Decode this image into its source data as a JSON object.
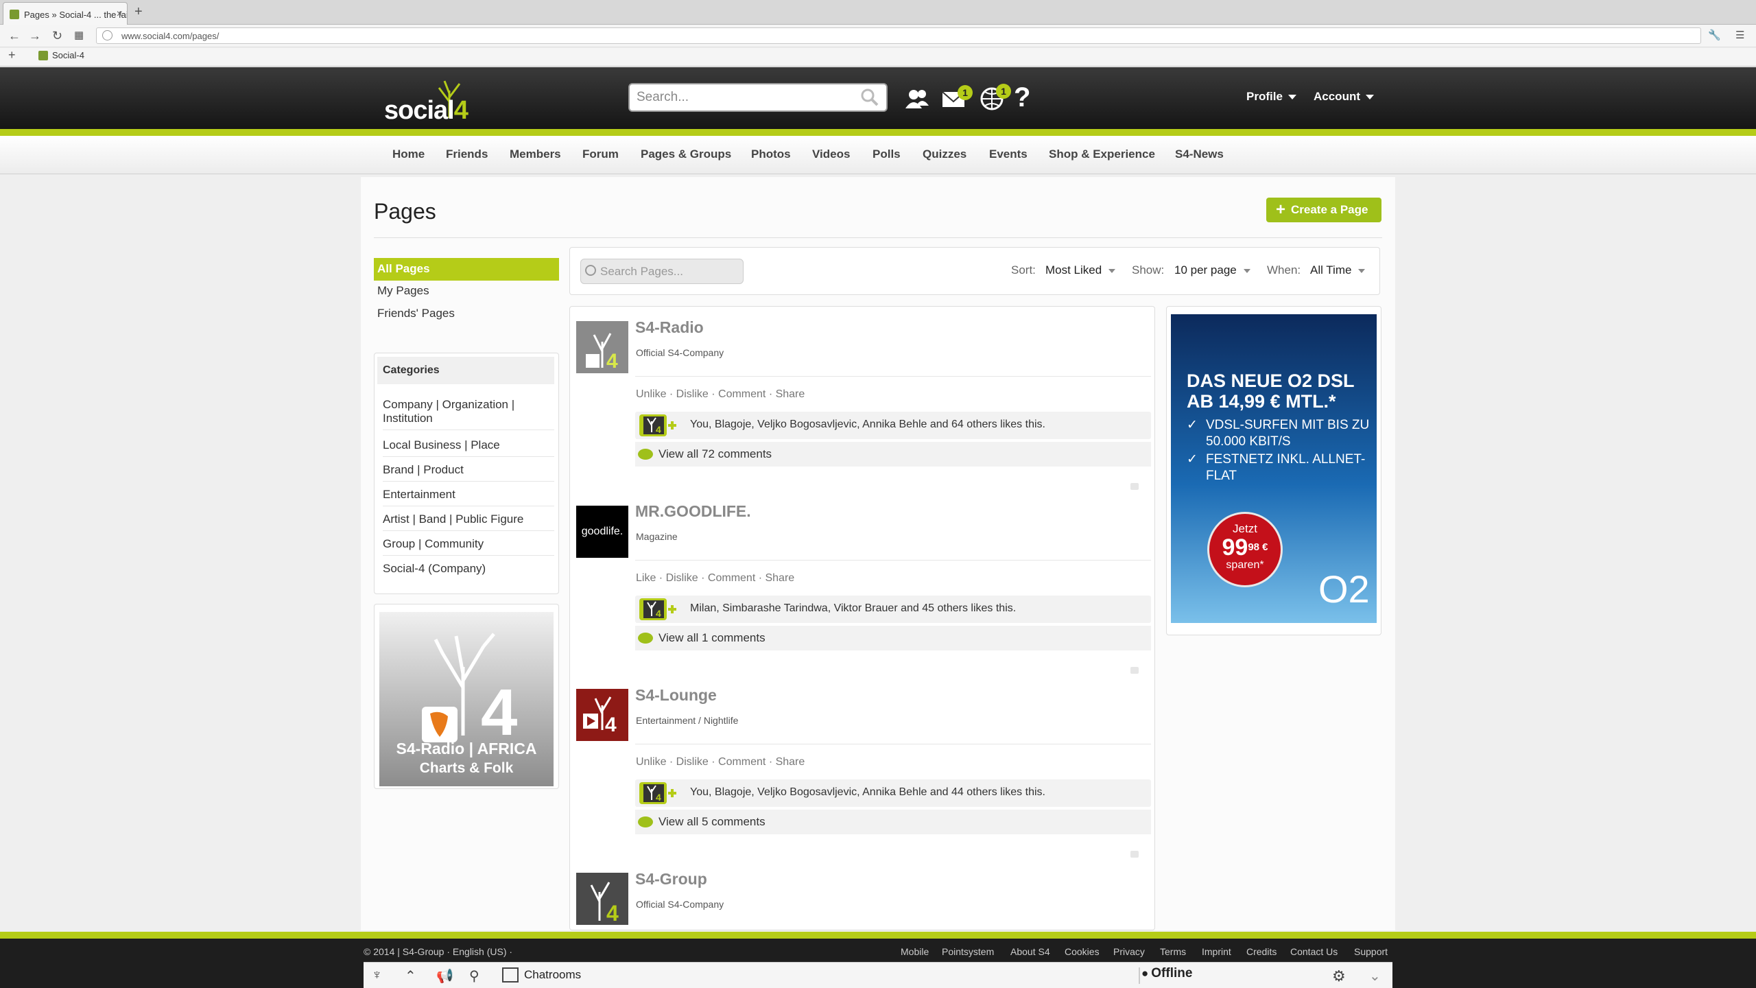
{
  "browser": {
    "tab_title": "Pages » Social-4 ... the fair",
    "url": "www.social4.com/pages/",
    "bookmark": "Social-4"
  },
  "header": {
    "logo_word": "social",
    "logo_number": "4",
    "search_placeholder": "Search...",
    "messages_badge": "1",
    "notifications_badge": "1",
    "help": "?",
    "profile": "Profile",
    "account": "Account"
  },
  "nav": [
    "Home",
    "Friends",
    "Members",
    "Forum",
    "Pages & Groups",
    "Photos",
    "Videos",
    "Polls",
    "Quizzes",
    "Events",
    "Shop & Experience",
    "S4-News"
  ],
  "page": {
    "title": "Pages",
    "create_button": "Create a Page"
  },
  "sidebar": {
    "filters": [
      "All Pages",
      "My Pages",
      "Friends' Pages"
    ],
    "categories_title": "Categories",
    "categories": [
      "Company | Organization | Institution",
      "Local Business | Place",
      "Brand | Product",
      "Entertainment",
      "Artist | Band | Public Figure",
      "Group | Community",
      "Social-4 (Company)"
    ],
    "promo_title": "S4-Radio | AFRICA",
    "promo_sub": "Charts & Folk",
    "promo_number": "4"
  },
  "toolbar": {
    "search_placeholder": "Search Pages...",
    "sort_label": "Sort:",
    "sort_value": "Most Liked",
    "show_label": "Show:",
    "show_value": "10 per page",
    "when_label": "When:",
    "when_value": "All Time"
  },
  "pages": [
    {
      "name": "S4-Radio",
      "category": "Official S4-Company",
      "actions": "Unlike · Dislike · Comment · Share",
      "likes": "You, Blagoje, Veljko Bogosavljevic, Annika Behle and 64 others likes this.",
      "comments": "View all 72 comments"
    },
    {
      "name": "MR.GOODLIFE.",
      "category": "Magazine",
      "actions": "Like · Dislike · Comment · Share",
      "likes": "Milan, Simbarashe Tarindwa, Viktor Brauer and 45 others likes this.",
      "comments": "View all 1 comments",
      "thumb_text": "goodlife."
    },
    {
      "name": "S4-Lounge",
      "category": "Entertainment / Nightlife",
      "actions": "Unlike · Dislike · Comment · Share",
      "likes": "You, Blagoje, Veljko Bogosavljevic, Annika Behle and 44 others likes this.",
      "comments": "View all 5 comments"
    },
    {
      "name": "S4-Group",
      "category": "Official S4-Company"
    }
  ],
  "ad": {
    "headline": "DAS NEUE O2 DSL AB 14,99 € MTL.*",
    "bullet1": "VDSL-SURFEN MIT BIS ZU 50.000 KBIT/S",
    "bullet2": "FESTNETZ INKL. ALLNET-FLAT",
    "circle_top": "Jetzt",
    "circle_price": "99",
    "circle_cents": "98 €",
    "circle_bottom": "sparen*",
    "brand": "O2"
  },
  "footer": {
    "copyright": "© 2014 | S4-Group · English (US) ·",
    "links": [
      "Mobile",
      "Pointsystem",
      "About S4",
      "Cookies",
      "Privacy",
      "Terms",
      "Imprint",
      "Credits",
      "Contact Us",
      "Support"
    ],
    "chatrooms": "Chatrooms",
    "status": "Offline"
  },
  "colors": {
    "accent": "#b5cc18",
    "button": "#9fc01a",
    "header": "#1e1e1e"
  }
}
